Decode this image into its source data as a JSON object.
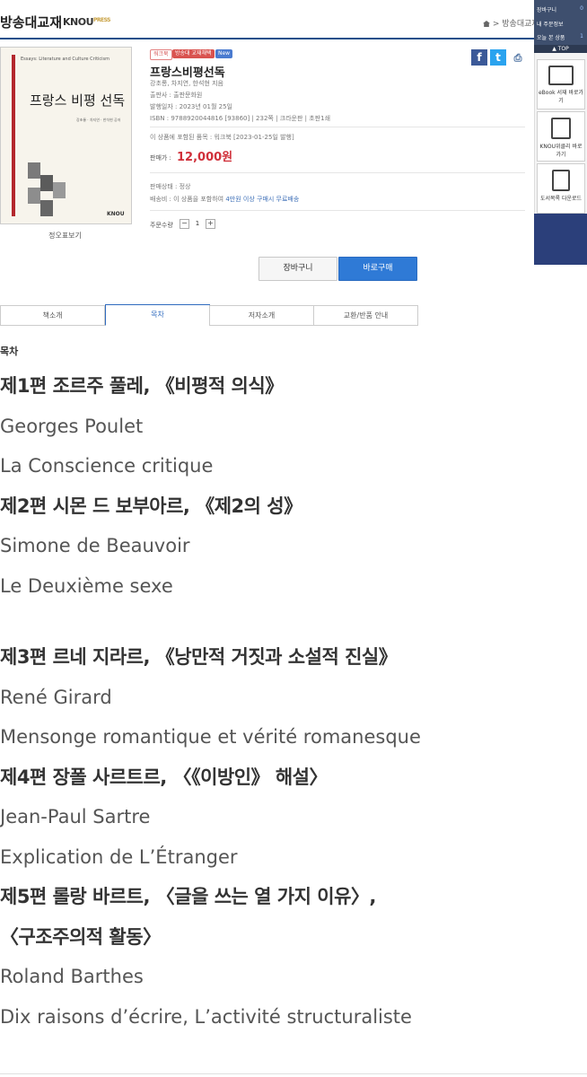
{
  "header": {
    "brand": "방송대교재",
    "brand_sub_1": "KNOU",
    "brand_sub_2": "PRESS",
    "breadcrumb": "> 방송대교재"
  },
  "right_panel": {
    "cart_label": "장바구니",
    "cart_count": "0",
    "orders_label": "내 주문정보",
    "viewed_label": "오늘 본 상품",
    "viewed_count": "1",
    "top_label": "▲ TOP",
    "ebook_label": "eBook 서재 바로가기",
    "quiz_label": "KNOU위클리 바로가기",
    "catalog_label": "도서목록 다운로드"
  },
  "cover": {
    "top_text": "Essays: Literature and Culture Criticism",
    "title": "프랑스 비평 선독",
    "authors": "강초롱 · 차지연 · 한석현 공저",
    "logo": "KNOU",
    "zoom_label": "정오표보기"
  },
  "product": {
    "badges": [
      "워크북",
      "방송대 교재채택",
      "New"
    ],
    "title": "프랑스비평선독",
    "authors": "강초롱, 차지연, 한석현 지음",
    "publisher": "출판사 : 출판문화원",
    "date": "발행일자 : 2023년 01월 25일",
    "isbn": "ISBN : 9788920044816 [93860]",
    "pages": "232쪽",
    "size": "크라운판",
    "edition": "초판1쇄",
    "included": "이 상품에 포함된 품목 : 워크북 [2023-01-25일 발행]",
    "price_label": "판매가 :",
    "price": "12,000원",
    "status": "판매상태 : 정상",
    "shipping_prefix": "배송비 : 이 상품을 포함하여",
    "shipping_highlight": "4만원 이상 구매시 무료배송",
    "qty_label": "주문수량",
    "qty": "1",
    "qty_minus": "−",
    "qty_plus": "+",
    "share_fb": "f",
    "share_tw": "t",
    "print": "⎙"
  },
  "buttons": {
    "cart": "장바구니",
    "buy": "바로구매"
  },
  "tabs": [
    "책소개",
    "목차",
    "저자소개",
    "교환/반품 안내"
  ],
  "toc": {
    "heading": "목차",
    "lines": [
      "제1편 조르주 풀레, 《비평적 의식》",
      "Georges Poulet",
      "La Conscience critique",
      "제2편 시몬 드 보부아르, 《제2의 성》",
      "Simone de Beauvoir",
      "Le Deuxième sexe",
      "제3편 르네 지라르, 《낭만적 거짓과 소설적 진실》",
      "René Girard",
      "Mensonge romantique et vérité romanesque",
      "제4편 장폴 사르트르, 〈《이방인》 해설〉",
      "Jean-Paul Sartre",
      "Explication de L’Étranger",
      "제5편 롤랑 바르트, 〈글을 쓰는 열 가지 이유〉,",
      "〈구조주의적 활동〉",
      "Roland Barthes",
      "Dix raisons d’écrire, L’activité structuraliste"
    ]
  }
}
